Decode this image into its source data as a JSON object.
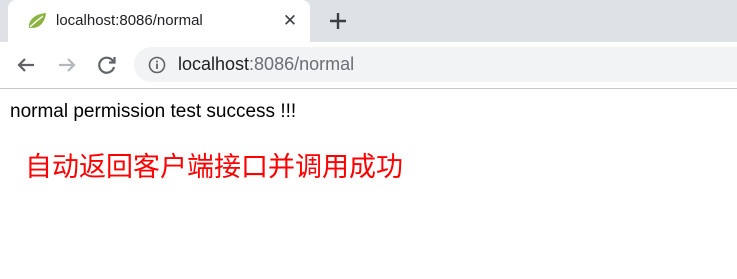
{
  "browser": {
    "tab": {
      "title": "localhost:8086/normal",
      "favicon": "spring-leaf-icon",
      "close": "✕"
    },
    "new_tab": "plus-icon",
    "toolbar": {
      "back": "back-arrow-icon",
      "forward": "forward-arrow-icon",
      "reload": "reload-icon",
      "site_info": "info-icon"
    },
    "address": {
      "host": "localhost",
      "rest": ":8086/normal"
    }
  },
  "page": {
    "line1": "normal permission test success !!!",
    "line2": "自动返回客户端接口并调用成功",
    "line2_color": "#ff0000"
  }
}
